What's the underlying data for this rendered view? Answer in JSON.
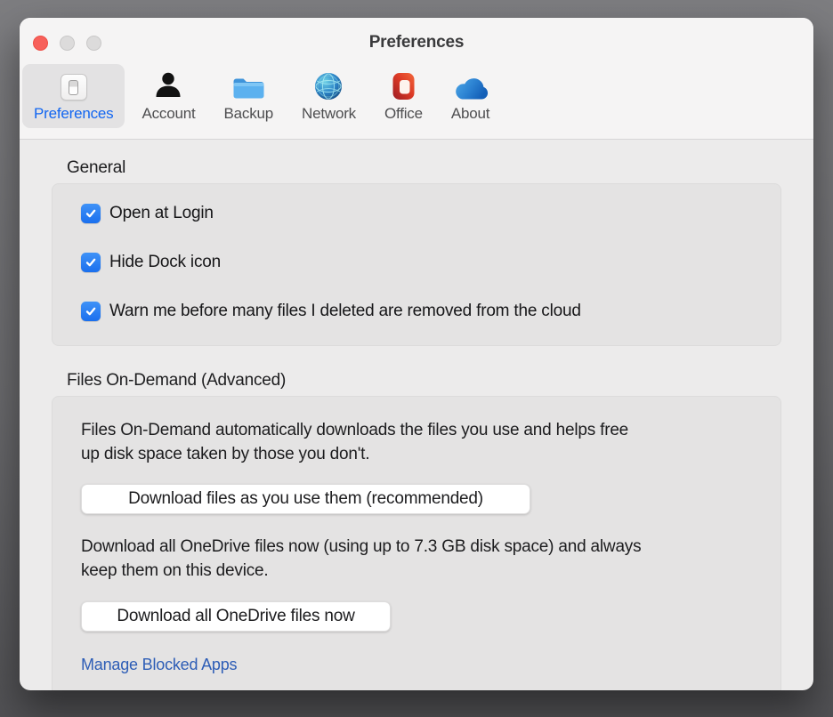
{
  "window": {
    "title": "Preferences"
  },
  "toolbar": {
    "tabs": [
      {
        "label": "Preferences",
        "icon": "switch-icon",
        "selected": true
      },
      {
        "label": "Account",
        "icon": "person-icon",
        "selected": false
      },
      {
        "label": "Backup",
        "icon": "folder-icon",
        "selected": false
      },
      {
        "label": "Network",
        "icon": "globe-icon",
        "selected": false
      },
      {
        "label": "Office",
        "icon": "office-logo-icon",
        "selected": false
      },
      {
        "label": "About",
        "icon": "onedrive-cloud-icon",
        "selected": false
      }
    ]
  },
  "general": {
    "heading": "General",
    "checkboxes": [
      {
        "label": "Open at Login",
        "checked": true
      },
      {
        "label": "Hide Dock icon",
        "checked": true
      },
      {
        "label": "Warn me before many files I deleted are removed from the cloud",
        "checked": true
      }
    ]
  },
  "files_on_demand": {
    "heading": "Files On-Demand (Advanced)",
    "description_line1": "Files On-Demand automatically downloads the files you use and helps free",
    "description_line2": "up disk space taken by those you don't.",
    "download_as_used_button": "Download files as you use them (recommended)",
    "download_all_line1": "Download all OneDrive files now (using up to 7.3 GB disk space) and always",
    "download_all_line2": "keep them on this device.",
    "download_all_button": "Download all OneDrive files now",
    "manage_blocked_apps_link": "Manage Blocked Apps"
  },
  "colors": {
    "accent_checkbox_blue": "#1d76f3",
    "selected_tab_text_blue": "#1266f1",
    "link_blue": "#2d5db6",
    "close_button_red": "#f7605a"
  }
}
